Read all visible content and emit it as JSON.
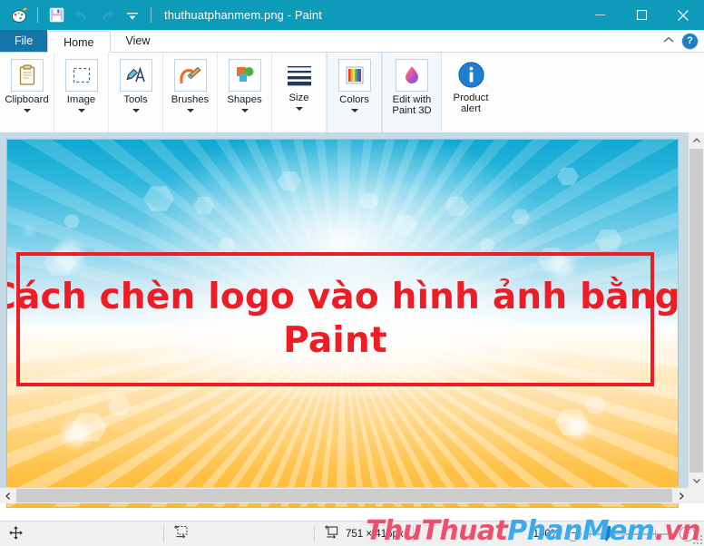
{
  "window": {
    "title": "thuthuatphanmem.png - Paint",
    "quick_access": [
      {
        "name": "paint-app-icon",
        "label": "Paint"
      },
      {
        "name": "save-icon",
        "label": "Save"
      },
      {
        "name": "undo-icon",
        "label": "Undo"
      },
      {
        "name": "redo-icon",
        "label": "Redo"
      },
      {
        "name": "customize-qat-icon",
        "label": "Customize Quick Access Toolbar"
      }
    ],
    "controls": [
      {
        "name": "minimize-button",
        "label": "Minimize"
      },
      {
        "name": "maximize-button",
        "label": "Maximize"
      },
      {
        "name": "close-button",
        "label": "Close"
      }
    ],
    "accent_color": "#0e9ab9"
  },
  "tabs": [
    {
      "label": "File",
      "type": "file"
    },
    {
      "label": "Home",
      "type": "active"
    },
    {
      "label": "View",
      "type": "normal"
    }
  ],
  "tabstrip_right": {
    "collapse_ribbon_label": "^",
    "help_label": "?"
  },
  "ribbon": {
    "groups": [
      {
        "items": [
          {
            "label": "Clipboard",
            "icon": "clipboard-icon",
            "caret": true
          }
        ]
      },
      {
        "items": [
          {
            "label": "Image",
            "icon": "select-rectangle-icon",
            "caret": true
          }
        ]
      },
      {
        "items": [
          {
            "label": "Tools",
            "icon": "tools-pencil-icon",
            "caret": true
          }
        ]
      },
      {
        "items": [
          {
            "label": "Brushes",
            "icon": "brush-icon",
            "caret": true
          }
        ]
      },
      {
        "items": [
          {
            "label": "Shapes",
            "icon": "shapes-icon",
            "caret": true
          }
        ]
      },
      {
        "items": [
          {
            "label": "Size",
            "icon": "line-size-icon",
            "caret": true
          }
        ]
      },
      {
        "boxed": true,
        "items": [
          {
            "label": "Colors",
            "icon": "color-palette-icon",
            "caret": true
          }
        ]
      },
      {
        "boxed": true,
        "items": [
          {
            "label": "Edit with\nPaint 3D",
            "line1": "Edit with",
            "line2": "Paint 3D",
            "icon": "paint3d-icon",
            "caret": false
          }
        ]
      },
      {
        "items": [
          {
            "label": "Product\nalert",
            "line1": "Product",
            "line2": "alert",
            "icon": "info-alert-icon",
            "caret": false
          }
        ]
      }
    ]
  },
  "canvas": {
    "image_title_line1": "Cách chèn logo vào hình ảnh bằng",
    "image_title_line2": "Paint",
    "title_color": "#ee1c25",
    "border_color": "#ee1c25",
    "sky_color": "#0fa8d2",
    "ground_color": "#fdb82f"
  },
  "status_bar": {
    "cursor_position_icon": "cursor-position-icon",
    "selection_size_icon": "selection-size-icon",
    "image_size_icon": "image-size-icon",
    "image_size": "751 × 416px",
    "zoom_level": "100%",
    "zoom_out_label": "−",
    "zoom_in_label": "+"
  },
  "watermark": {
    "part1": "ThuThuat",
    "part2": "PhanMem",
    "part3": ".vn",
    "color1": "#ef4f6d",
    "color2": "#3aabef"
  }
}
